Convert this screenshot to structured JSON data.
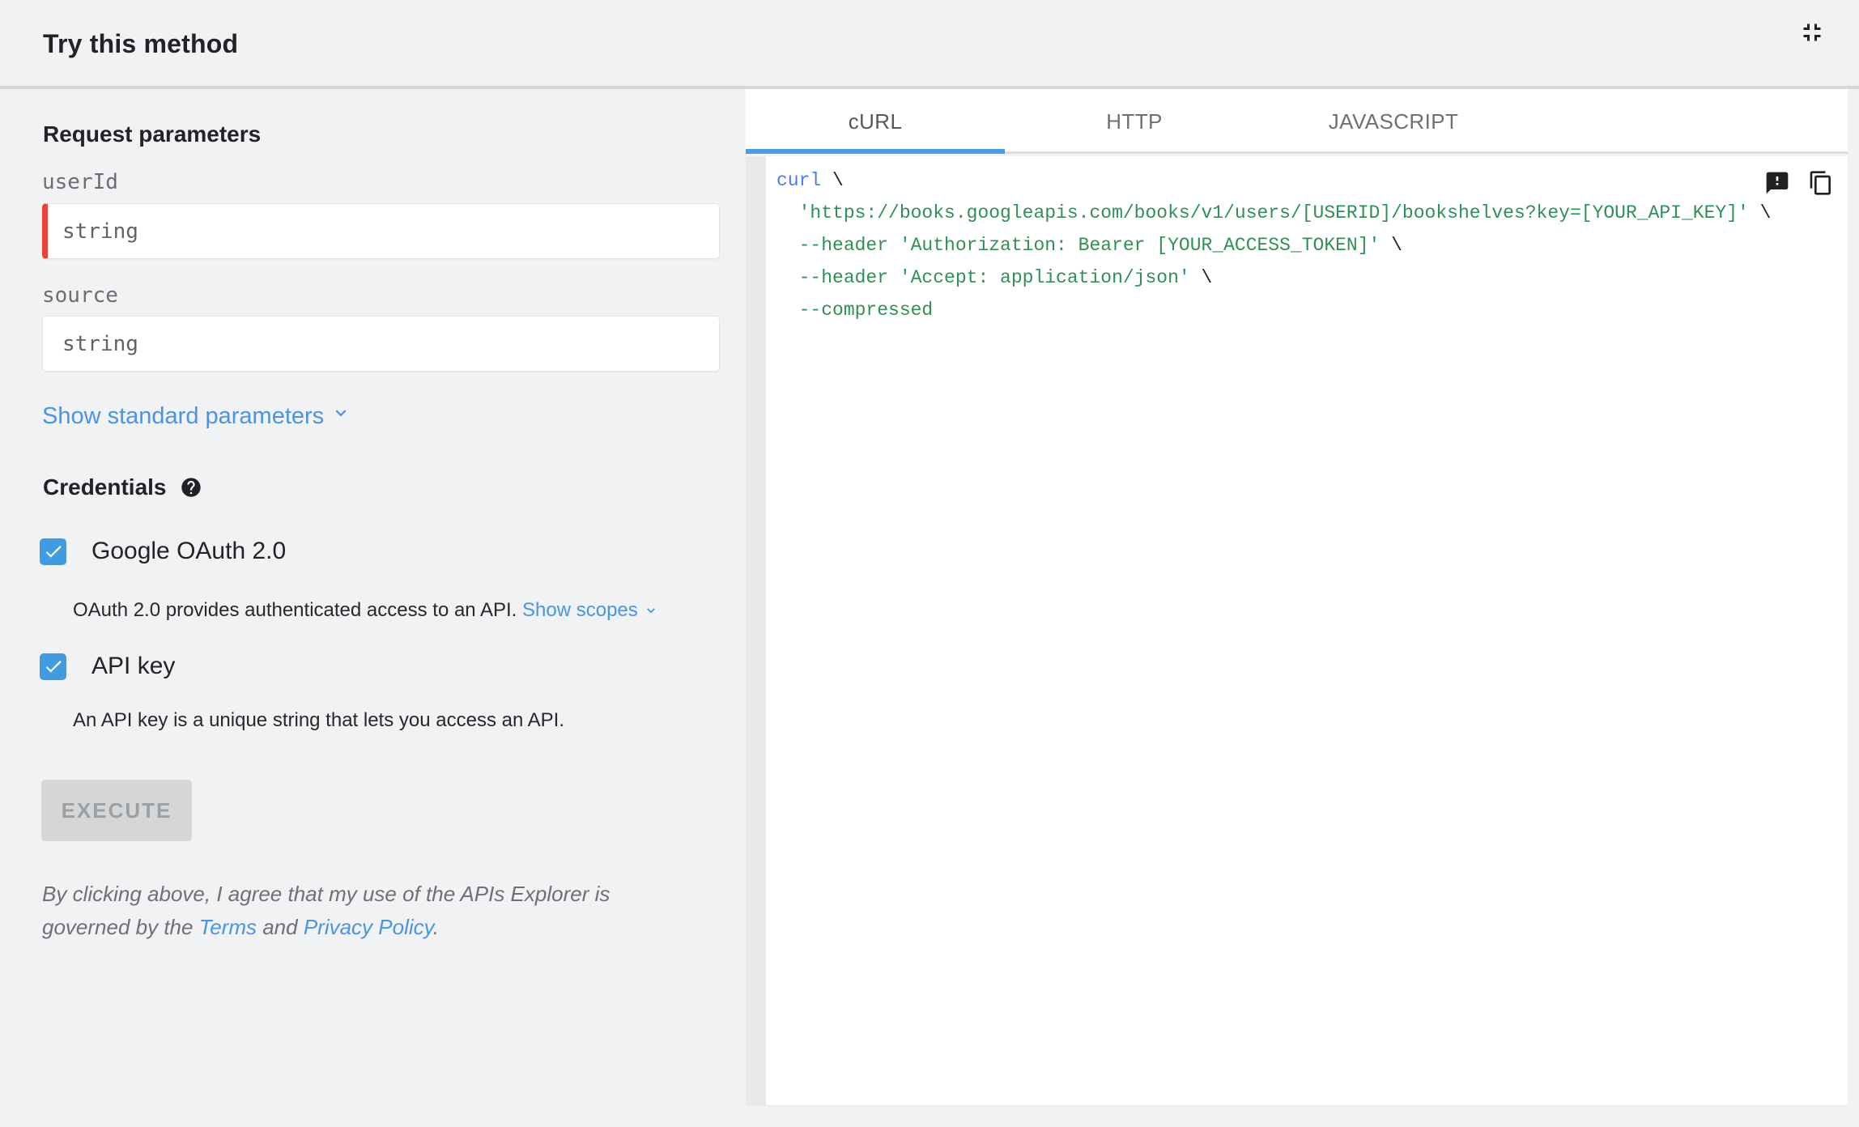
{
  "header": {
    "title": "Try this method",
    "collapse_icon": "fullscreen-exit"
  },
  "left": {
    "section_params_title": "Request parameters",
    "fields": [
      {
        "label": "userId",
        "value": "",
        "placeholder": "string",
        "required": true
      },
      {
        "label": "source",
        "value": "",
        "placeholder": "string",
        "required": false
      }
    ],
    "show_standard_label": "Show standard parameters",
    "credentials_title": "Credentials",
    "credentials": [
      {
        "label": "Google OAuth 2.0",
        "checked": true,
        "description": "OAuth 2.0 provides authenticated access to an API.",
        "link_label": "Show scopes"
      },
      {
        "label": "API key",
        "checked": true,
        "description": "An API key is a unique string that lets you access an API.",
        "link_label": null
      }
    ],
    "execute_label": "EXECUTE",
    "legal": {
      "prefix": "By clicking above, I agree that my use of the APIs Explorer is governed by the ",
      "terms_link": "Terms",
      "middle": " and ",
      "privacy_link": "Privacy Policy",
      "suffix": "."
    }
  },
  "tabs": [
    {
      "label": "cURL",
      "active": true
    },
    {
      "label": "HTTP",
      "active": false
    },
    {
      "label": "JAVASCRIPT",
      "active": false
    }
  ],
  "code": {
    "language": "cURL",
    "lines": [
      [
        {
          "t": "curl",
          "c": "kw"
        },
        {
          "t": " \\",
          "c": "pln"
        }
      ],
      [
        {
          "t": "  ",
          "c": "pln"
        },
        {
          "t": "'https://books.googleapis.com/books/v1/users/[USERID]/bookshelves?key=[YOUR_API_KEY]'",
          "c": "str"
        },
        {
          "t": " \\",
          "c": "pln"
        }
      ],
      [
        {
          "t": "  ",
          "c": "pln"
        },
        {
          "t": "--header 'Authorization: Bearer [YOUR_ACCESS_TOKEN]'",
          "c": "str"
        },
        {
          "t": " \\",
          "c": "pln"
        }
      ],
      [
        {
          "t": "  ",
          "c": "pln"
        },
        {
          "t": "--header 'Accept: application/json'",
          "c": "str"
        },
        {
          "t": " \\",
          "c": "pln"
        }
      ],
      [
        {
          "t": "  ",
          "c": "pln"
        },
        {
          "t": "--compressed",
          "c": "str"
        }
      ]
    ],
    "action_icons": [
      "feedback-icon",
      "copy-icon"
    ]
  },
  "colors": {
    "page_bg": "#f1f2f4",
    "accent_link_blue": "#4795e8",
    "checkbox_blue": "#3f9be2",
    "tab_underline_blue": "#4a9be4",
    "required_red": "#e8443a",
    "code_keyword_blue": "#4b80ea",
    "code_string_green": "#2e9155",
    "execute_disabled_bg": "#d5d6d8"
  }
}
